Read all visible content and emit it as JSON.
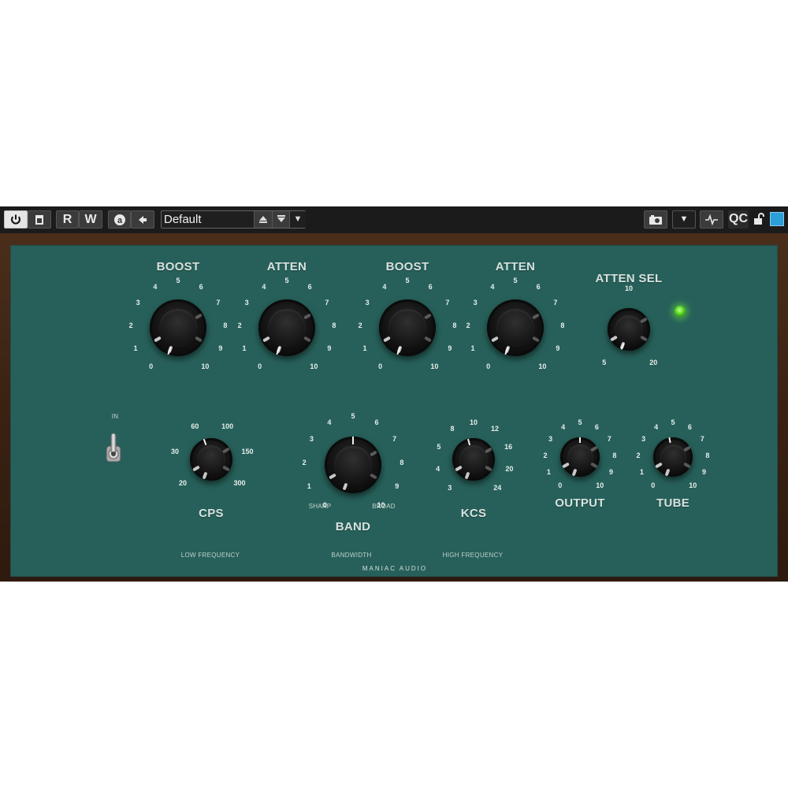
{
  "toolbar": {
    "power_icon": "power-icon",
    "bypass_icon": "compare-icon",
    "read_label": "R",
    "write_label": "W",
    "automation_icon": "a-circle-icon",
    "back_icon": "arrow-left-icon",
    "preset_name": "Default",
    "camera_icon": "camera-icon",
    "dropdown_icon": "chevron-down-icon",
    "waveform_icon": "waveform-icon",
    "qc_label": "QC",
    "lock_icon": "unlock-icon",
    "color_swatch": "#2b9fd8"
  },
  "plugin": {
    "brand": "MANIAC AUDIO",
    "in_label": "IN",
    "top_knobs": [
      {
        "label": "BOOST",
        "scale": [
          "0",
          "1",
          "2",
          "3",
          "4",
          "5",
          "6",
          "7",
          "8",
          "9",
          "10"
        ]
      },
      {
        "label": "ATTEN",
        "scale": [
          "0",
          "1",
          "2",
          "3",
          "4",
          "5",
          "6",
          "7",
          "8",
          "9",
          "10"
        ]
      },
      {
        "label": "BOOST",
        "scale": [
          "0",
          "1",
          "2",
          "3",
          "4",
          "5",
          "6",
          "7",
          "8",
          "9",
          "10"
        ]
      },
      {
        "label": "ATTEN",
        "scale": [
          "0",
          "1",
          "2",
          "3",
          "4",
          "5",
          "6",
          "7",
          "8",
          "9",
          "10"
        ]
      }
    ],
    "atten_sel": {
      "label": "ATTEN SEL",
      "scale": [
        "5",
        "10",
        "20"
      ]
    },
    "cps": {
      "label": "CPS",
      "scale": [
        "20",
        "30",
        "60",
        "100",
        "150",
        "300"
      ],
      "section": "LOW FREQUENCY"
    },
    "band": {
      "label": "BAND",
      "scale": [
        "0",
        "1",
        "2",
        "3",
        "4",
        "5",
        "6",
        "7",
        "8",
        "9",
        "10"
      ],
      "left_text": "SHARP",
      "right_text": "BROAD",
      "section": "BANDWIDTH"
    },
    "kcs": {
      "label": "KCS",
      "scale": [
        "3",
        "4",
        "5",
        "8",
        "10",
        "12",
        "16",
        "20",
        "24"
      ],
      "section": "HIGH FREQUENCY"
    },
    "output": {
      "label": "OUTPUT",
      "scale": [
        "0",
        "1",
        "2",
        "3",
        "4",
        "5",
        "6",
        "7",
        "8",
        "9",
        "10"
      ]
    },
    "tube": {
      "label": "TUBE",
      "scale": [
        "0",
        "1",
        "2",
        "3",
        "4",
        "5",
        "6",
        "7",
        "8",
        "9",
        "10"
      ]
    },
    "colors": {
      "panel": "#27605a",
      "frame": "#3a2213",
      "led": "#5fdc2c"
    }
  }
}
